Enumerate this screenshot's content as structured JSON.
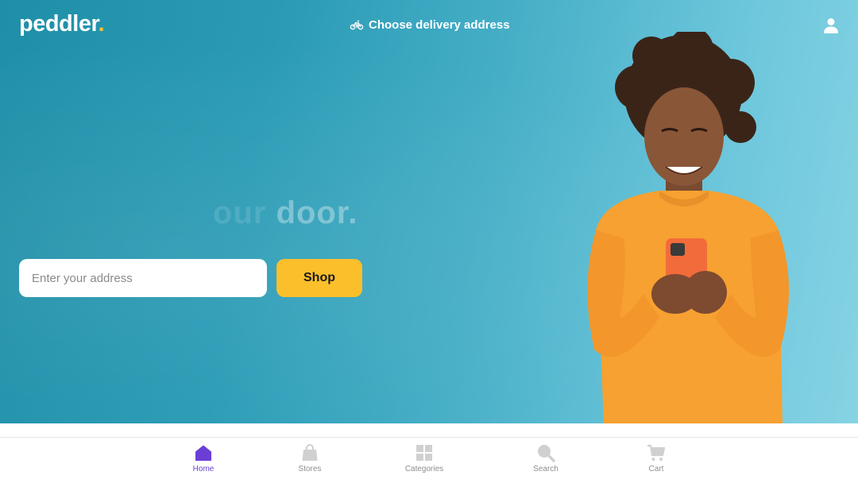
{
  "header": {
    "logo_text": "peddler",
    "logo_dot": ".",
    "delivery_label": "Choose delivery address",
    "user_icon": "user-icon"
  },
  "hero": {
    "tagline_faint": "our",
    "tagline_text": "door.",
    "address_placeholder": "Enter your address",
    "address_value": "",
    "shop_label": "Shop"
  },
  "bottom_nav": {
    "items": [
      {
        "label": "Home",
        "icon": "home-icon",
        "active": true
      },
      {
        "label": "Stores",
        "icon": "shopping-bag-icon",
        "active": false
      },
      {
        "label": "Categories",
        "icon": "grid-icon",
        "active": false
      },
      {
        "label": "Search",
        "icon": "search-icon",
        "active": false
      },
      {
        "label": "Cart",
        "icon": "cart-icon",
        "active": false
      }
    ]
  },
  "colors": {
    "accent": "#fbbf2c",
    "active_nav": "#6b3fd6",
    "hero_bg": "#2a9bb5",
    "inactive_icon": "#d0d0d0"
  }
}
